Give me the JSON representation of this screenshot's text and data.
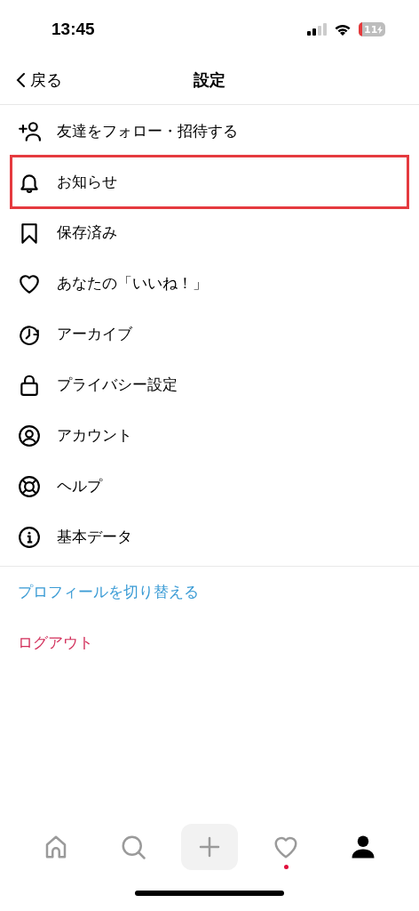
{
  "status_bar": {
    "time": "13:45",
    "battery": "11"
  },
  "header": {
    "back": "戻る",
    "title": "設定"
  },
  "items": [
    {
      "label": "友達をフォロー・招待する",
      "highlighted": false
    },
    {
      "label": "お知らせ",
      "highlighted": true
    },
    {
      "label": "保存済み",
      "highlighted": false
    },
    {
      "label": "あなたの「いいね！」",
      "highlighted": false
    },
    {
      "label": "アーカイブ",
      "highlighted": false
    },
    {
      "label": "プライバシー設定",
      "highlighted": false
    },
    {
      "label": "アカウント",
      "highlighted": false
    },
    {
      "label": "ヘルプ",
      "highlighted": false
    },
    {
      "label": "基本データ",
      "highlighted": false
    }
  ],
  "links": [
    {
      "kind": "switch",
      "label": "プロフィールを切り替える"
    },
    {
      "kind": "logout",
      "label": "ログアウト"
    }
  ],
  "tab_bar": [
    {
      "selected": false,
      "badge": false
    },
    {
      "selected": false,
      "badge": false
    },
    {
      "selected": false,
      "badge": false
    },
    {
      "selected": false,
      "badge": true
    },
    {
      "selected": true,
      "badge": false
    }
  ]
}
